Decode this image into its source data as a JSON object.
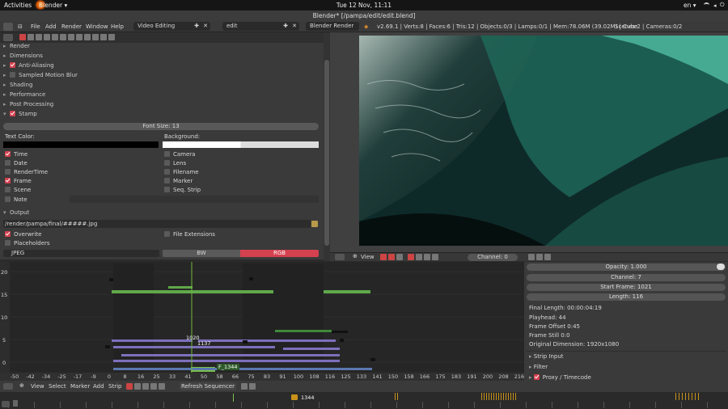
{
  "topbar": {
    "activities": "Activities",
    "app": "Blender ▾",
    "clock": "Tue 12 Nov, 11:11",
    "lang": "en ▾"
  },
  "window": {
    "title": "Blender* [/pampa/edit/edit.blend]"
  },
  "infobar": {
    "menu": [
      "File",
      "Add",
      "Render",
      "Window",
      "Help"
    ],
    "screen": "Video Editing",
    "scene": "edit",
    "engine": "Blender Render",
    "stats": "v2.69.1 | Verts:8 | Faces:6 | Tris:12 | Objects:0/3 | Lamps:0/1 | Mem:78.06M (39.02M) | Cube",
    "scenes": "Scenes:2 | Cameras:0/2"
  },
  "props": {
    "panels": [
      "Render",
      "Dimensions",
      "Anti-Aliasing",
      "Sampled Motion Blur",
      "Shading",
      "Performance",
      "Post Processing",
      "Stamp"
    ],
    "font_size": "Font Size: 13",
    "text_color_label": "Text Color:",
    "background_label": "Background:",
    "stamp_left": [
      "Time",
      "Date",
      "RenderTime",
      "Frame",
      "Scene",
      "Note"
    ],
    "stamp_right": [
      "Camera",
      "Lens",
      "Filename",
      "Marker",
      "Seq. Strip"
    ],
    "output_panel": "Output",
    "output_path": "/render/pampa/final/#####.jpg",
    "overwrite": "Overwrite",
    "file_ext": "File Extensions",
    "placeholders": "Placeholders",
    "format": "JPEG",
    "bw": "BW",
    "rgb": "RGB"
  },
  "preview": {
    "view": "View",
    "channel": "Channel: 0"
  },
  "sequencer": {
    "yticks": [
      "20",
      "15",
      "10",
      "5",
      "0"
    ],
    "xticks": [
      "-50",
      "-42",
      "-34",
      "-25",
      "-17",
      "-9",
      "0",
      "8",
      "16",
      "25",
      "33",
      "41",
      "50",
      "58",
      "66",
      "75",
      "83",
      "91",
      "100",
      "108",
      "116",
      "125",
      "133",
      "141",
      "150",
      "158",
      "166",
      "175",
      "183",
      "191",
      "200",
      "208",
      "216"
    ],
    "cursor_frame": "1020",
    "label_1137": "1137",
    "label_f1344": "F_1344",
    "menu": [
      "View",
      "Select",
      "Marker",
      "Add",
      "Strip"
    ],
    "refresh": "Refresh Sequencer",
    "frame": "1344"
  },
  "strip": {
    "opacity": "Opacity: 1.000",
    "channel": "Channel: 7",
    "start": "Start Frame: 1021",
    "length": "Length: 116",
    "final_length": "Final Length: 00:00:04:19",
    "playhead": "Playhead: 44",
    "offset": "Frame Offset 0:45",
    "still": "Frame Still 0:0",
    "dimension": "Original Dimension: 1920x1080",
    "sections": [
      "Strip Input",
      "Filter",
      "Proxy / Timecode"
    ]
  }
}
